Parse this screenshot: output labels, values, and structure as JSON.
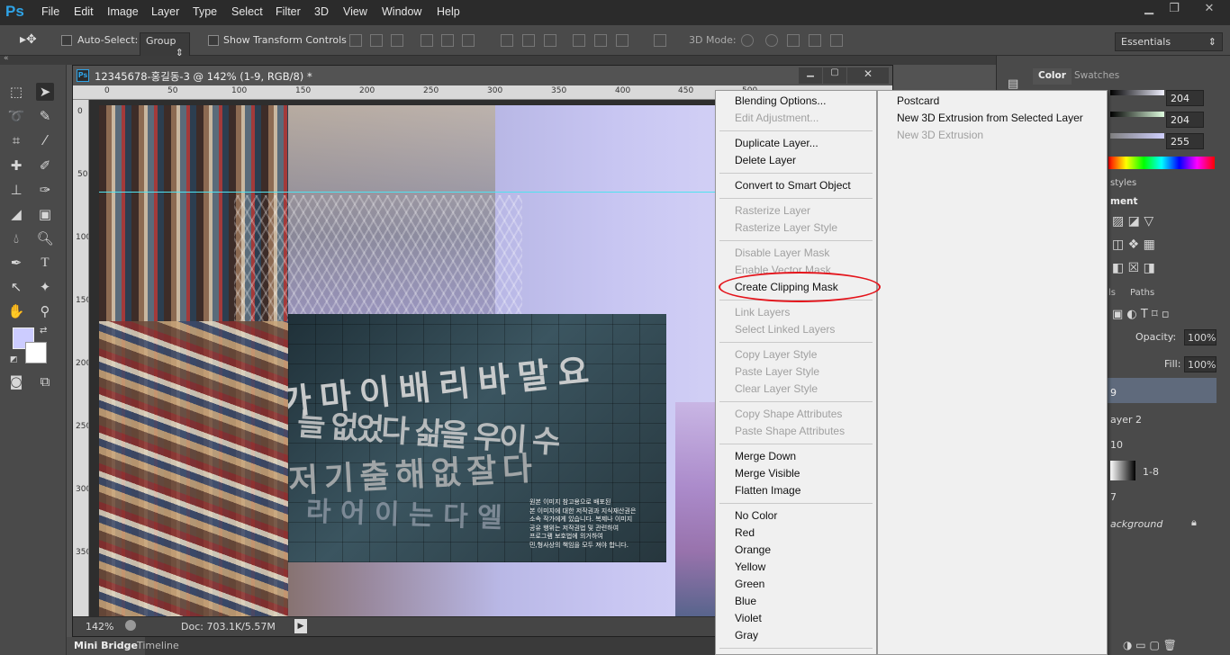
{
  "app": {
    "logo": "Ps"
  },
  "menubar": {
    "items": [
      "File",
      "Edit",
      "Image",
      "Layer",
      "Type",
      "Select",
      "Filter",
      "3D",
      "View",
      "Window",
      "Help"
    ]
  },
  "options_bar": {
    "auto_select_label": "Auto-Select:",
    "auto_select_value": "Group",
    "show_transform_label": "Show Transform Controls",
    "mode_3d_label": "3D Mode:",
    "workspace": "Essentials"
  },
  "document": {
    "title": "12345678-홍길동-3 @ 142% (1-9, RGB/8) *",
    "zoom": "142%",
    "doc_size": "Doc: 703.1K/5.57M",
    "ruler_top_ticks": [
      "0",
      "50",
      "100",
      "150",
      "200",
      "250",
      "300",
      "350",
      "400",
      "450",
      "500"
    ],
    "ruler_left_ticks": [
      "0",
      "50",
      "100",
      "150",
      "200",
      "250",
      "300",
      "350"
    ],
    "poster_text_lines": [
      "원본 이미지 참고용으로 배포된",
      "본 이미지에 대한 저작권과 지식재산권은",
      "소속 작가에게 있습니다. 복제나 이미지",
      "공유 행위는 저작권법 및 관련하여",
      "프로그램 보호법에 의거하여",
      "민,형사상의 책임을 모두 져야 합니다."
    ]
  },
  "bottom_tabs": [
    "Mini Bridge",
    "Timeline"
  ],
  "right_panel": {
    "color_tabs": [
      "Color",
      "Swatches"
    ],
    "color_values": [
      "204",
      "204",
      "255"
    ],
    "adjustments_tab_fragment": "styles",
    "adjustments_heading_fragment": "ment",
    "layers_tabs_fragments": [
      "ls",
      "Paths"
    ],
    "opacity_label": "Opacity:",
    "opacity_value": "100%",
    "fill_label": "Fill:",
    "fill_value": "100%",
    "layers": [
      "9",
      "ayer 2",
      "10",
      "1-8",
      "7",
      "ackground"
    ]
  },
  "context_menu": {
    "items": [
      {
        "label": "Blending Options...",
        "enabled": true
      },
      {
        "label": "Edit Adjustment...",
        "enabled": false
      },
      {
        "label": "Duplicate Layer...",
        "enabled": true
      },
      {
        "label": "Delete Layer",
        "enabled": true
      },
      {
        "label": "Convert to Smart Object",
        "enabled": true
      },
      {
        "label": "Rasterize Layer",
        "enabled": false
      },
      {
        "label": "Rasterize Layer Style",
        "enabled": false
      },
      {
        "label": "Disable Layer Mask",
        "enabled": false
      },
      {
        "label": "Enable Vector Mask",
        "enabled": false
      },
      {
        "label": "Create Clipping Mask",
        "enabled": true
      },
      {
        "label": "Link Layers",
        "enabled": false
      },
      {
        "label": "Select Linked Layers",
        "enabled": false
      },
      {
        "label": "Copy Layer Style",
        "enabled": false
      },
      {
        "label": "Paste Layer Style",
        "enabled": false
      },
      {
        "label": "Clear Layer Style",
        "enabled": false
      },
      {
        "label": "Copy Shape Attributes",
        "enabled": false
      },
      {
        "label": "Paste Shape Attributes",
        "enabled": false
      },
      {
        "label": "Merge Down",
        "enabled": true
      },
      {
        "label": "Merge Visible",
        "enabled": true
      },
      {
        "label": "Flatten Image",
        "enabled": true
      },
      {
        "label": "No Color",
        "enabled": true
      },
      {
        "label": "Red",
        "enabled": true
      },
      {
        "label": "Orange",
        "enabled": true
      },
      {
        "label": "Yellow",
        "enabled": true
      },
      {
        "label": "Green",
        "enabled": true
      },
      {
        "label": "Blue",
        "enabled": true
      },
      {
        "label": "Violet",
        "enabled": true
      },
      {
        "label": "Gray",
        "enabled": true
      }
    ]
  },
  "submenu": {
    "items": [
      {
        "label": "Postcard",
        "enabled": true
      },
      {
        "label": "New 3D Extrusion from Selected Layer",
        "enabled": true
      },
      {
        "label": "New 3D Extrusion",
        "enabled": false
      }
    ]
  },
  "colors": {
    "highlight_ellipse": "#e4141b",
    "menu_bg": "#f0f0f0",
    "app_bg": "#535353"
  }
}
